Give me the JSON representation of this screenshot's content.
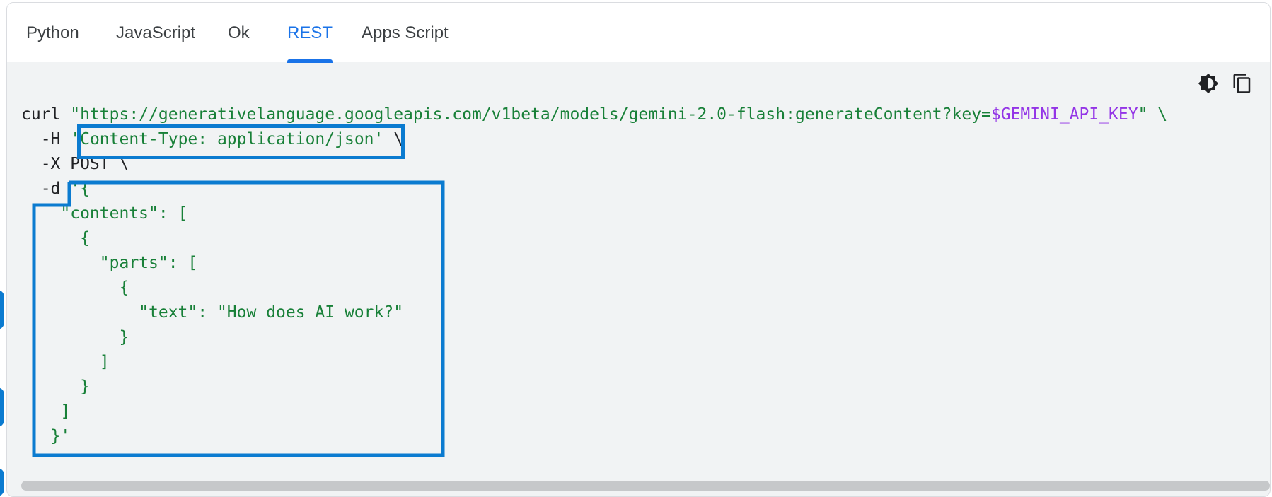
{
  "tabs": [
    {
      "label": "Python"
    },
    {
      "label": "JavaScript"
    },
    {
      "label": "Ok"
    },
    {
      "label": "REST",
      "active": true
    },
    {
      "label": "Apps Script"
    }
  ],
  "toolbar": {
    "theme_icon": "contrast-icon",
    "copy_icon": "copy-icon"
  },
  "code": {
    "l1_cmd": "curl ",
    "l1_url": "\"https://generativelanguage.googleapis.com/v1beta/models/gemini-2.0-flash:generateContent?key=",
    "l1_var": "$GEMINI_API_KEY",
    "l1_end": "\" \\",
    "l2_flag": "  -H ",
    "l2_str": "'Content-Type: application/json'",
    "l2_end": " \\",
    "l3": "  -X POST \\",
    "l4_flag": "  -d ",
    "body": "'{\n    \"contents\": [\n      {\n        \"parts\": [\n          {\n            \"text\": \"How does AI work?\"\n          }\n        ]\n      }\n    ]\n   }'"
  },
  "colors": {
    "accent": "#1a73e8",
    "highlight_box": "#0b7bd0",
    "string": "#188038",
    "variable": "#9334e6",
    "code_bg": "#f1f3f4"
  }
}
